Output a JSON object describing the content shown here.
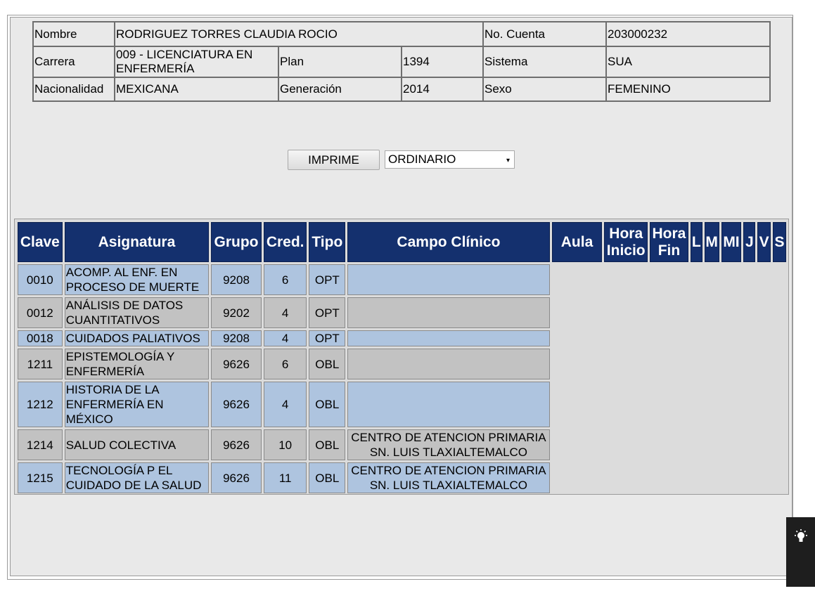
{
  "student": {
    "nombre_label": "Nombre",
    "nombre": "RODRIGUEZ TORRES CLAUDIA ROCIO",
    "cuenta_label": "No. Cuenta",
    "cuenta": "203000232",
    "carrera_label": "Carrera",
    "carrera": "009 - LICENCIATURA EN ENFERMERÍA",
    "plan_label": "Plan",
    "plan": "1394",
    "sistema_label": "Sistema",
    "sistema": "SUA",
    "nacionalidad_label": "Nacionalidad",
    "nacionalidad": "MEXICANA",
    "generacion_label": "Generación",
    "generacion": "2014",
    "sexo_label": "Sexo",
    "sexo": "FEMENINO"
  },
  "controls": {
    "print_label": "IMPRIME",
    "period_selected": "ORDINARIO",
    "dropdown_arrow": "▾"
  },
  "schedule": {
    "headers": {
      "clave": "Clave",
      "asignatura": "Asignatura",
      "grupo": "Grupo",
      "cred": "Cred.",
      "tipo": "Tipo",
      "campo": "Campo Clínico",
      "aula": "Aula",
      "hora_inicio": "Hora Inicio",
      "hora_fin": "Hora Fin",
      "l": "L",
      "m": "M",
      "mi": "MI",
      "j": "J",
      "v": "V",
      "s": "S"
    },
    "rows": [
      {
        "clave": "0010",
        "asignatura": "ACOMP. AL ENF. EN PROCESO DE MUERTE",
        "grupo": "9208",
        "cred": "6",
        "tipo": "OPT",
        "campo": ""
      },
      {
        "clave": "0012",
        "asignatura": "ANÁLISIS DE DATOS CUANTITATIVOS",
        "grupo": "9202",
        "cred": "4",
        "tipo": "OPT",
        "campo": ""
      },
      {
        "clave": "0018",
        "asignatura": "CUIDADOS PALIATIVOS",
        "grupo": "9208",
        "cred": "4",
        "tipo": "OPT",
        "campo": ""
      },
      {
        "clave": "1211",
        "asignatura": "EPISTEMOLOGÍA Y ENFERMERÍA",
        "grupo": "9626",
        "cred": "6",
        "tipo": "OBL",
        "campo": ""
      },
      {
        "clave": "1212",
        "asignatura": "HISTORIA DE LA ENFERMERÍA EN MÉXICO",
        "grupo": "9626",
        "cred": "4",
        "tipo": "OBL",
        "campo": ""
      },
      {
        "clave": "1214",
        "asignatura": "SALUD COLECTIVA",
        "grupo": "9626",
        "cred": "10",
        "tipo": "OBL",
        "campo": "CENTRO DE ATENCION PRIMARIA SN. LUIS TLAXIALTEMALCO"
      },
      {
        "clave": "1215",
        "asignatura": "TECNOLOGÍA P EL CUIDADO DE LA SALUD",
        "grupo": "9626",
        "cred": "11",
        "tipo": "OBL",
        "campo": "CENTRO DE ATENCION PRIMARIA SN. LUIS TLAXIALTEMALCO"
      }
    ]
  },
  "colors": {
    "header_bg": "#14306e",
    "row_blue": "#aec4df",
    "row_gray": "#c2c2c2"
  },
  "icons": {
    "tip_button": "lightbulb-icon"
  }
}
